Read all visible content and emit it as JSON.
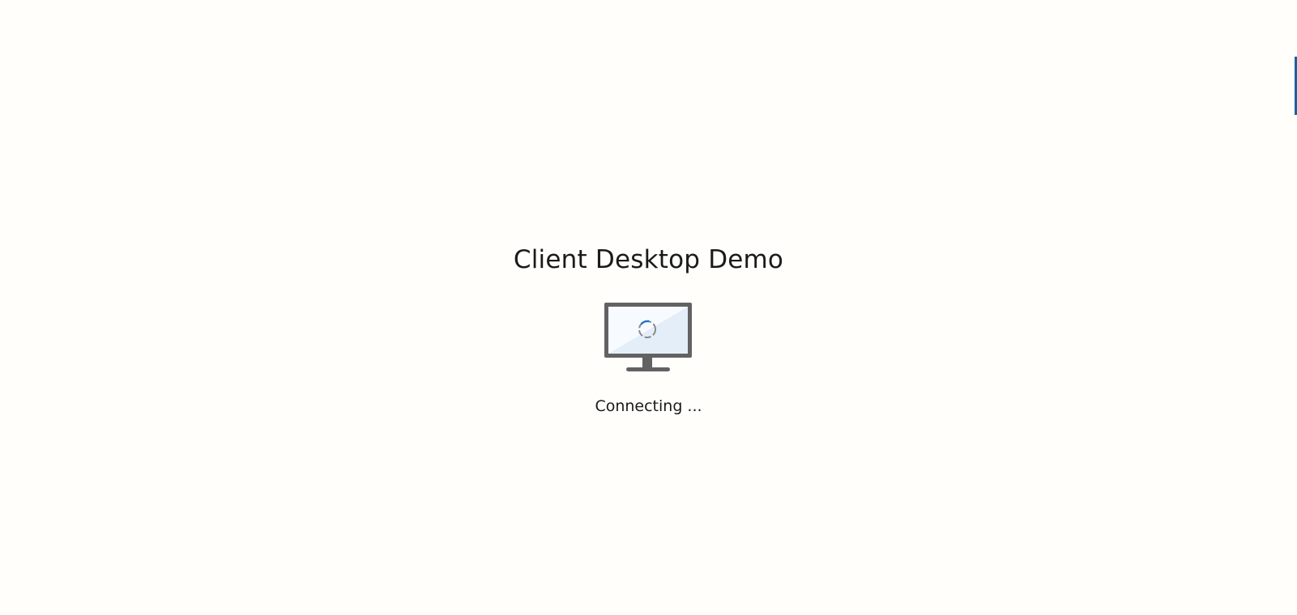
{
  "app": {
    "title": "Client Desktop Demo"
  },
  "status": {
    "text": "Connecting ..."
  },
  "icons": {
    "monitor": "monitor-icon",
    "spinner": "loading-spinner-icon"
  },
  "colors": {
    "background": "#fffefb",
    "monitor_frame": "#626262",
    "monitor_screen": "#e8f1fb",
    "spinner_accent": "#1f74c8",
    "spinner_base": "#8a8a8a"
  }
}
